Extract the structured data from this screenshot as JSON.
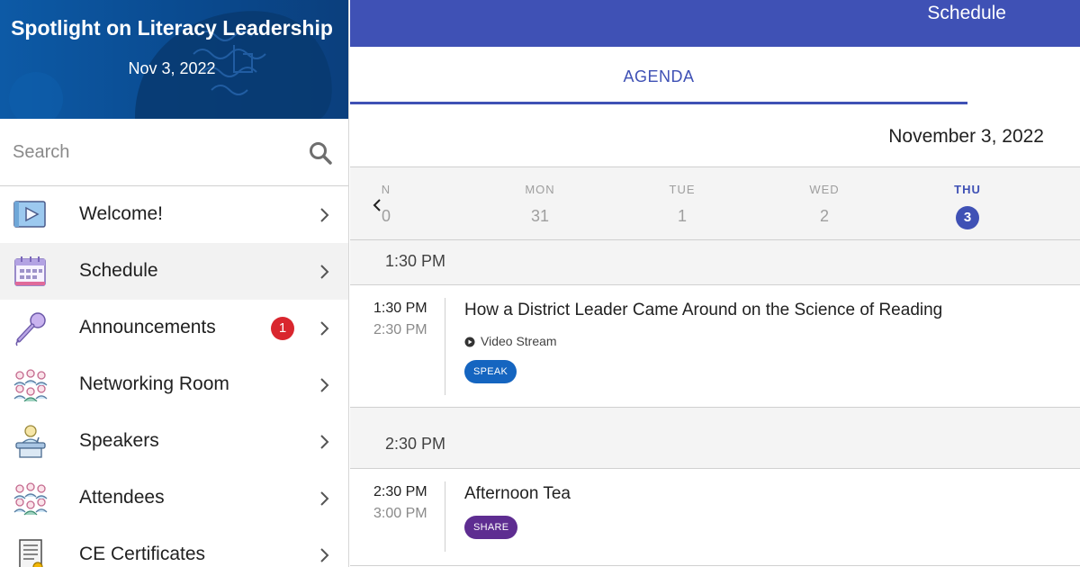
{
  "sidebar": {
    "event_title": "Spotlight on Literacy Leadership",
    "event_date": "Nov 3, 2022",
    "search_placeholder": "Search",
    "items": [
      {
        "label": "Welcome!",
        "icon": "video-play-icon"
      },
      {
        "label": "Schedule",
        "icon": "calendar-icon",
        "active": true
      },
      {
        "label": "Announcements",
        "icon": "microphone-icon",
        "badge": "1"
      },
      {
        "label": "Networking Room",
        "icon": "group-icon"
      },
      {
        "label": "Speakers",
        "icon": "podium-icon"
      },
      {
        "label": "Attendees",
        "icon": "people-icon"
      },
      {
        "label": "CE Certificates",
        "icon": "certificate-icon"
      }
    ]
  },
  "header": {
    "title": "Schedule"
  },
  "tabs": [
    {
      "label": "AGENDA",
      "active": true
    }
  ],
  "date_heading": "November 3, 2022",
  "week": {
    "days": [
      {
        "name": "N",
        "num": "0"
      },
      {
        "name": "MON",
        "num": "31"
      },
      {
        "name": "TUE",
        "num": "1"
      },
      {
        "name": "WED",
        "num": "2"
      },
      {
        "name": "THU",
        "num": "3",
        "selected": true
      }
    ]
  },
  "timeslots": [
    {
      "heading": "1:30 PM",
      "sessions": [
        {
          "start": "1:30 PM",
          "end": "2:30 PM",
          "title": "How a District Leader Came Around on the Science of Reading",
          "meta": "Video Stream",
          "tag": "SPEAK"
        }
      ]
    },
    {
      "heading": "2:30 PM",
      "sessions": [
        {
          "start": "2:30 PM",
          "end": "3:00 PM",
          "title": "Afternoon Tea",
          "tag": "SHARE"
        }
      ]
    }
  ],
  "colors": {
    "primary": "#3f51b5",
    "banner": "#0a4a8f",
    "badge": "#d9262e",
    "speak_tag": "#1565c0",
    "share_tag": "#5e2d91"
  }
}
